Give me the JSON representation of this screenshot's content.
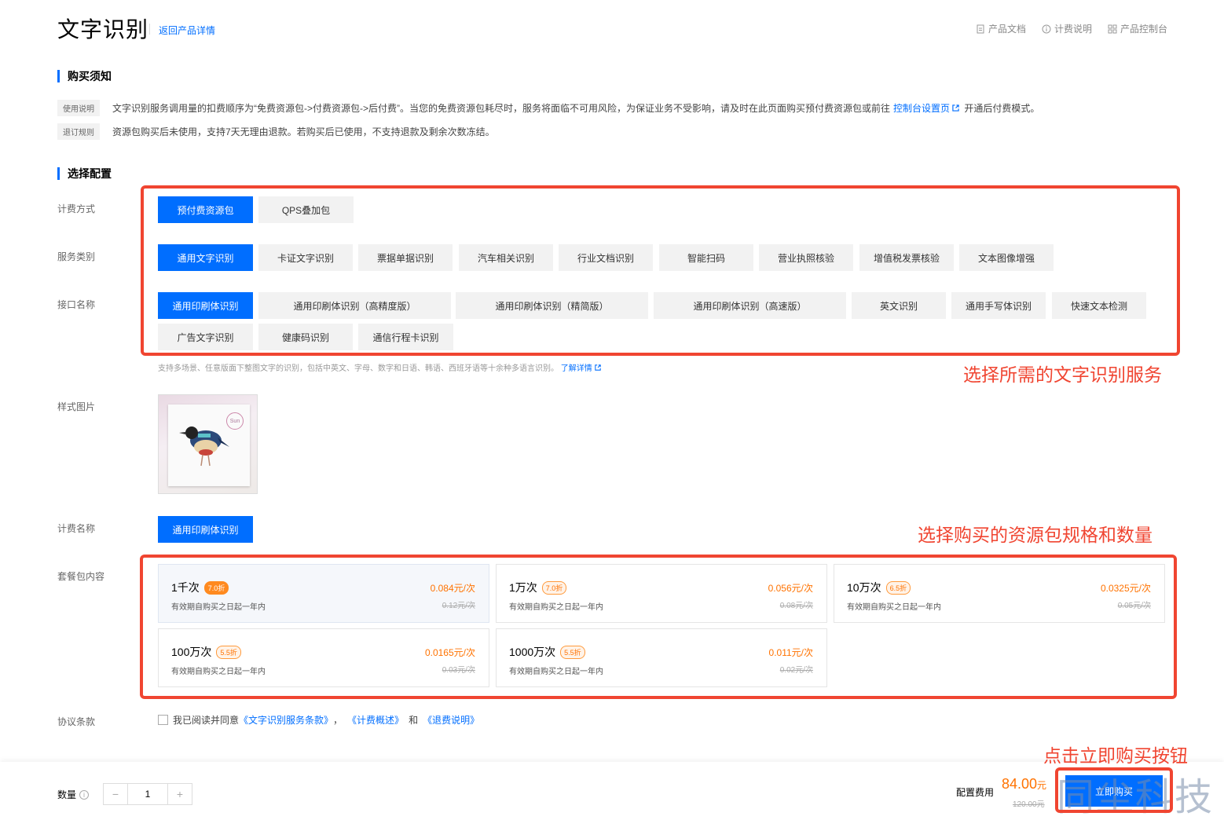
{
  "header": {
    "title": "文字识别",
    "back_link": "返回产品详情",
    "links": [
      {
        "label": "产品文档",
        "icon": "doc-icon"
      },
      {
        "label": "计费说明",
        "icon": "info-icon"
      },
      {
        "label": "产品控制台",
        "icon": "grid-icon"
      }
    ]
  },
  "notice": {
    "heading": "购买须知",
    "rows": [
      {
        "tag": "使用说明",
        "text": "文字识别服务调用量的扣费顺序为“免费资源包->付费资源包->后付费”。当您的免费资源包耗尽时，服务将面临不可用风险，为保证业务不受影响，请及时在此页面购买预付费资源包或前往",
        "link": "控制台设置页",
        "tail": "开通后付费模式。"
      },
      {
        "tag": "退订规则",
        "text": "资源包购买后未使用，支持7天无理由退款。若购买后已使用，不支持退款及剩余次数冻结。"
      }
    ]
  },
  "config": {
    "heading": "选择配置",
    "billing_label": "计费方式",
    "billing_options": [
      "预付费资源包",
      "QPS叠加包"
    ],
    "service_label": "服务类别",
    "service_options": [
      "通用文字识别",
      "卡证文字识别",
      "票据单据识别",
      "汽车相关识别",
      "行业文档识别",
      "智能扫码",
      "营业执照核验",
      "增值税发票核验",
      "文本图像增强"
    ],
    "api_label": "接口名称",
    "api_options": [
      "通用印刷体识别",
      "通用印刷体识别（高精度版）",
      "通用印刷体识别（精简版）",
      "通用印刷体识别（高速版）",
      "英文识别",
      "通用手写体识别",
      "快速文本检测",
      "广告文字识别",
      "健康码识别",
      "通信行程卡识别"
    ],
    "hint": "支持多场景、任意版面下整图文字的识别，包括中英文、字母、数字和日语、韩语、西班牙语等十余种多语言识别。",
    "hint_link": "了解详情",
    "sample_label": "样式图片",
    "sample_card_text": "Sun",
    "fee_name_label": "计费名称",
    "fee_name_value": "通用印刷体识别",
    "package_label": "套餐包内容",
    "packages": [
      {
        "name": "1千次",
        "discount": "7.0折",
        "desc": "有效期自购买之日起一年内",
        "price": "0.084元/次",
        "orig": "0.12元/次",
        "selected": true
      },
      {
        "name": "1万次",
        "discount": "7.0折",
        "desc": "有效期自购买之日起一年内",
        "price": "0.056元/次",
        "orig": "0.08元/次"
      },
      {
        "name": "10万次",
        "discount": "6.5折",
        "desc": "有效期自购买之日起一年内",
        "price": "0.0325元/次",
        "orig": "0.05元/次"
      },
      {
        "name": "100万次",
        "discount": "5.5折",
        "desc": "有效期自购买之日起一年内",
        "price": "0.0165元/次",
        "orig": "0.03元/次"
      },
      {
        "name": "1000万次",
        "discount": "5.5折",
        "desc": "有效期自购买之日起一年内",
        "price": "0.011元/次",
        "orig": "0.02元/次"
      }
    ],
    "agreement_label": "协议条款",
    "agreement_text": "我已阅读并同意",
    "agreement_links": [
      "《文字识别服务条款》",
      "《计费概述》",
      "《退费说明》"
    ],
    "agreement_sep1": "，",
    "agreement_sep2": "和"
  },
  "annotations": {
    "service": "选择所需的文字识别服务",
    "package": "选择购买的资源包规格和数量",
    "buy": "点击立即购买按钮"
  },
  "bottom": {
    "qty_label": "数量",
    "qty_value": "1",
    "minus": "−",
    "plus": "+",
    "fee_label": "配置费用",
    "fee_price": "84.00",
    "fee_unit": "元",
    "fee_orig": "120.00元",
    "buy_label": "立即购买",
    "watermark": "同尘科技"
  },
  "colors": {
    "accent": "#006eff",
    "price": "#ff7200",
    "annotation": "#f04531"
  }
}
